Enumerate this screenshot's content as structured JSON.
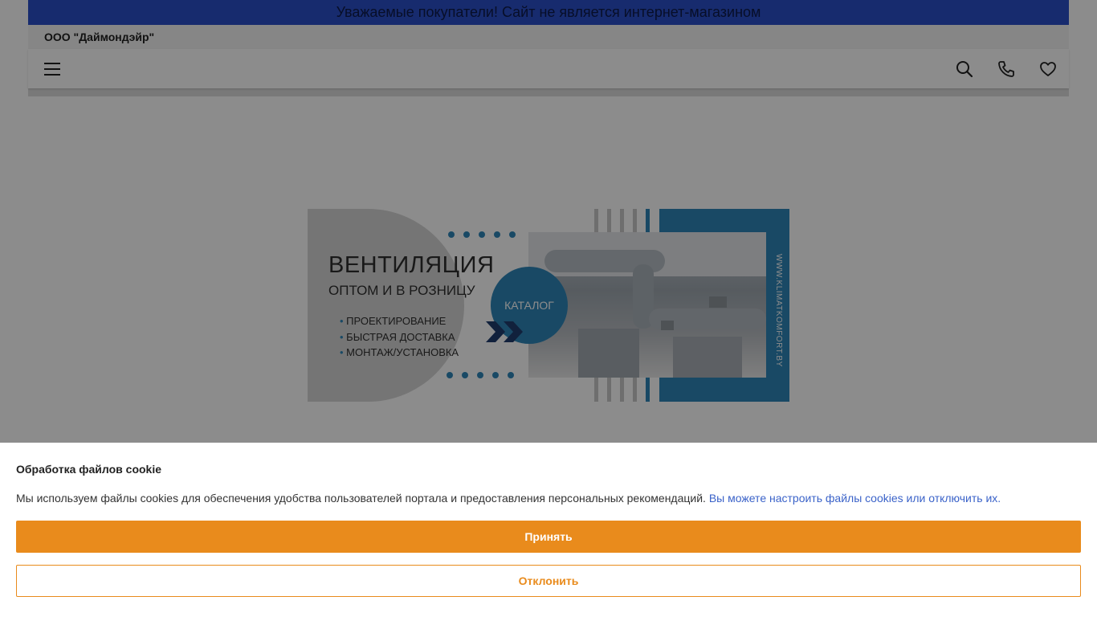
{
  "announcement": "Уважаемые покупатели! Сайт не является интернет-магазином",
  "company_name": "ООО \"Даймондэйр\"",
  "nav": {
    "menu_icon": "hamburger-menu-icon",
    "icons": [
      "search-icon",
      "phone-icon",
      "heart-icon"
    ]
  },
  "banner": {
    "title": "ВЕНТИЛЯЦИЯ",
    "subtitle": "ОПТОМ И В РОЗНИЦУ",
    "list": [
      "ПРОЕКТИРОВАНИЕ",
      "БЫСТРАЯ ДОСТАВКА",
      "МОНТАЖ/УСТАНОВКА"
    ],
    "button": "КАТАЛОГ",
    "url": "WWW.KLIMATKOMFORT.BY"
  },
  "cookie": {
    "title": "Обработка файлов cookie",
    "text": "Мы используем файлы cookies для обеспечения удобства пользователей портала и предоставления персональных рекомендаций.",
    "link": "Вы можете настроить файлы cookies или отключить их.",
    "accept": "Принять",
    "decline": "Отклонить"
  },
  "colors": {
    "announcement_bg": "#2b4fc9",
    "banner_accent": "#2e86b8",
    "accept_button": "#e98b1c",
    "link": "#3b63c9"
  }
}
